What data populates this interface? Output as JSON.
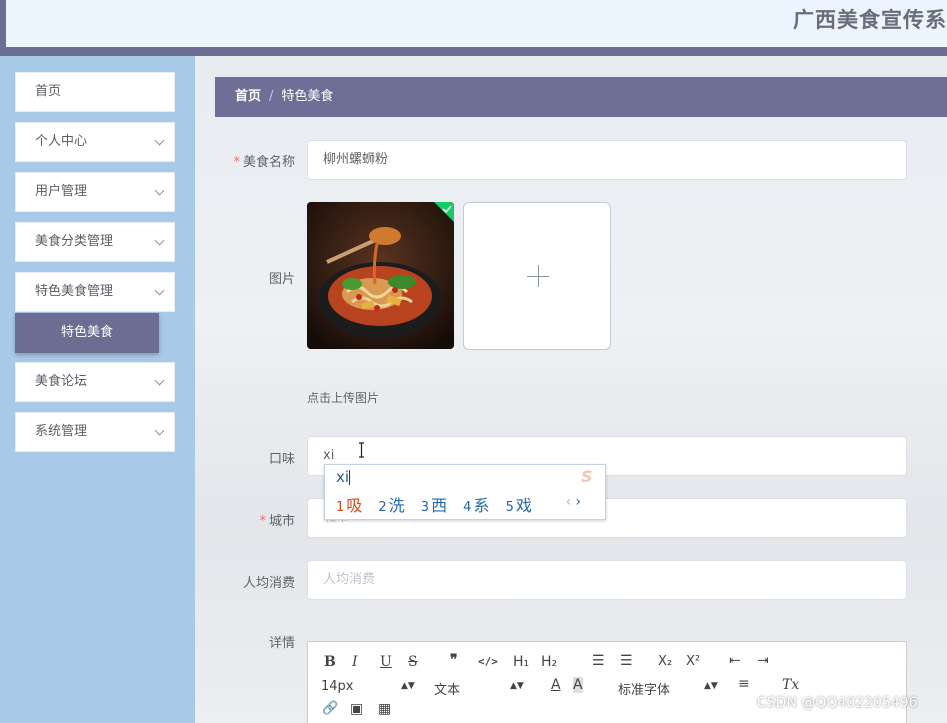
{
  "header": {
    "site_title": "广西美食宣传系"
  },
  "sidebar": {
    "items": [
      {
        "label": "首页"
      },
      {
        "label": "个人中心"
      },
      {
        "label": "用户管理"
      },
      {
        "label": "美食分类管理"
      },
      {
        "label": "特色美食管理"
      },
      {
        "label": "美食论坛"
      },
      {
        "label": "系统管理"
      }
    ],
    "active_sub": "特色美食"
  },
  "breadcrumb": {
    "home": "首页",
    "separator": "/",
    "current": "特色美食"
  },
  "form": {
    "name": {
      "label": "美食名称",
      "required": true,
      "value": "柳州螺蛳粉"
    },
    "image": {
      "label": "图片",
      "upload_tip": "点击上传图片",
      "uploaded": true
    },
    "taste": {
      "label": "口味",
      "value": "xi"
    },
    "city": {
      "label": "城市",
      "required": true,
      "placeholder": "城市"
    },
    "avg_cost": {
      "label": "人均消费",
      "placeholder": "人均消费"
    },
    "detail": {
      "label": "详情"
    }
  },
  "ime": {
    "composition": "xi",
    "candidates": [
      {
        "n": "1",
        "text": "吸"
      },
      {
        "n": "2",
        "text": "洗"
      },
      {
        "n": "3",
        "text": "西"
      },
      {
        "n": "4",
        "text": "系"
      },
      {
        "n": "5",
        "text": "戏"
      }
    ],
    "prev": "‹",
    "next": "›"
  },
  "editor_toolbar": {
    "bold": "B",
    "italic": "I",
    "underline": "U",
    "strike": "S",
    "quote": "❞",
    "code": "</>",
    "h1": "H₁",
    "h2": "H₂",
    "ordered": "☰",
    "bullet": "☰",
    "sub": "X₂",
    "sup": "X²",
    "outdent": "⇤",
    "indent": "⇥",
    "size": "14px",
    "block": "文本",
    "font": "标准字体",
    "color": "A",
    "bg": "A",
    "align": "≡",
    "clean": "Tx",
    "link": "🔗",
    "image": "▣",
    "video": "▦"
  },
  "watermark": "CSDN @QQ402205496",
  "colors": {
    "primary": "#6d6f97",
    "sidebar": "#a9c9e8",
    "required": "#f56c6c"
  }
}
